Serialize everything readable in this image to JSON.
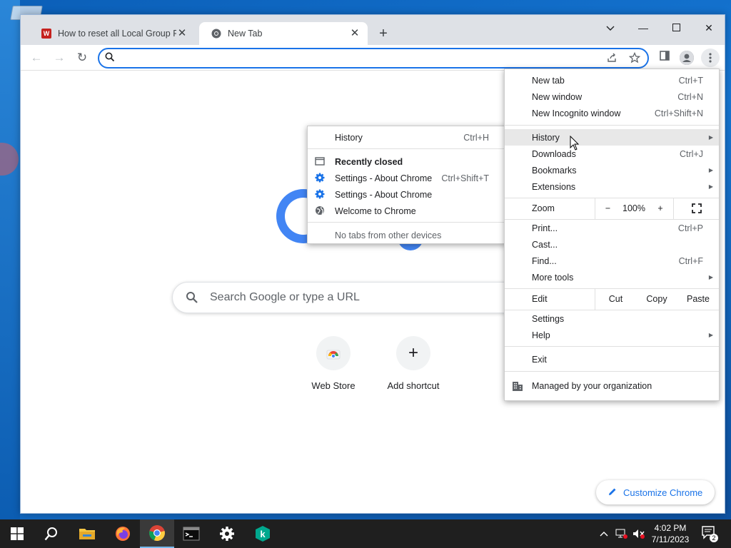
{
  "browser": {
    "tabs": [
      {
        "title": "How to reset all Local Group Polic"
      },
      {
        "title": "New Tab"
      }
    ],
    "omnibox": {
      "placeholder": ""
    }
  },
  "ntp": {
    "search_placeholder": "Search Google or type a URL",
    "shortcuts": [
      {
        "label": "Web Store",
        "icon": "web-store-icon"
      },
      {
        "label": "Add shortcut",
        "icon": "plus-icon"
      }
    ],
    "customize_label": "Customize Chrome"
  },
  "menu": {
    "new_tab": {
      "label": "New tab",
      "shortcut": "Ctrl+T"
    },
    "new_window": {
      "label": "New window",
      "shortcut": "Ctrl+N"
    },
    "incognito": {
      "label": "New Incognito window",
      "shortcut": "Ctrl+Shift+N"
    },
    "history": {
      "label": "History"
    },
    "downloads": {
      "label": "Downloads",
      "shortcut": "Ctrl+J"
    },
    "bookmarks": {
      "label": "Bookmarks"
    },
    "extensions": {
      "label": "Extensions"
    },
    "zoom": {
      "label": "Zoom",
      "minus": "−",
      "value": "100%",
      "plus": "+"
    },
    "print": {
      "label": "Print...",
      "shortcut": "Ctrl+P"
    },
    "cast": {
      "label": "Cast..."
    },
    "find": {
      "label": "Find...",
      "shortcut": "Ctrl+F"
    },
    "more_tools": {
      "label": "More tools"
    },
    "edit": {
      "label": "Edit",
      "cut": "Cut",
      "copy": "Copy",
      "paste": "Paste"
    },
    "settings": {
      "label": "Settings"
    },
    "help": {
      "label": "Help"
    },
    "exit": {
      "label": "Exit"
    },
    "managed": {
      "label": "Managed by your organization"
    }
  },
  "history_submenu": {
    "history": {
      "label": "History",
      "shortcut": "Ctrl+H"
    },
    "recently_closed": {
      "label": "Recently closed"
    },
    "items": [
      {
        "label": "Settings - About Chrome",
        "shortcut": "Ctrl+Shift+T",
        "icon": "gear-icon"
      },
      {
        "label": "Settings - About Chrome",
        "shortcut": "",
        "icon": "gear-icon"
      },
      {
        "label": "Welcome to Chrome",
        "shortcut": "",
        "icon": "globe-icon"
      }
    ],
    "no_tabs": {
      "label": "No tabs from other devices"
    }
  },
  "taskbar": {
    "time": "4:02 PM",
    "date": "7/11/2023",
    "notification_count": "2",
    "apps": [
      "start-icon",
      "search-icon",
      "file-explorer-icon",
      "firefox-icon",
      "chrome-icon",
      "terminal-icon",
      "settings-icon",
      "kaspersky-icon"
    ]
  },
  "colors": {
    "accent": "#1a73e8",
    "google_blue": "#4285f4",
    "taskbar": "#1f1f1f"
  }
}
